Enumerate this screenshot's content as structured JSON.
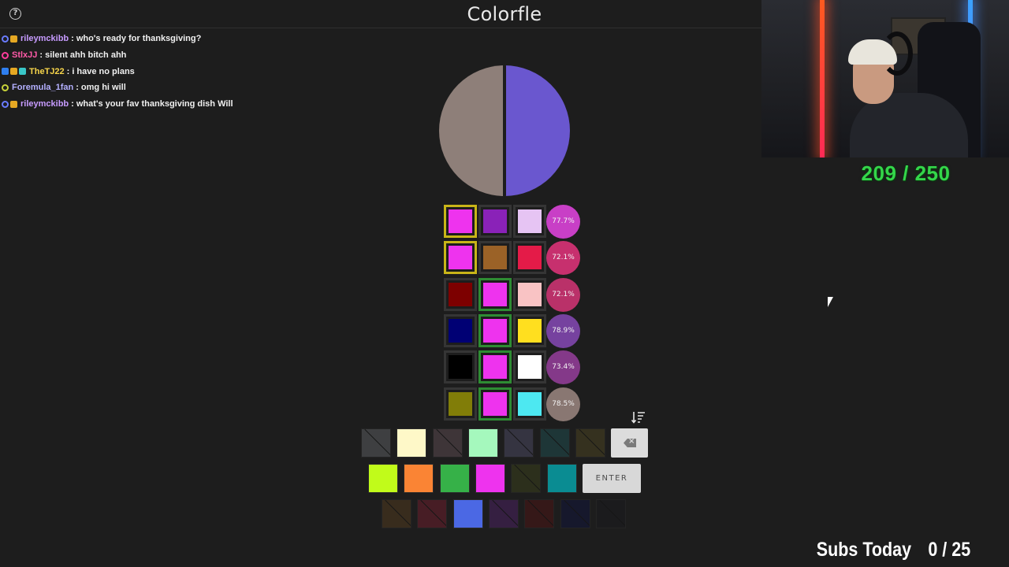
{
  "app": {
    "title": "Colorfle",
    "help_icon": "question-circle-icon",
    "help_glyph": "?"
  },
  "chat": [
    {
      "badges": [
        {
          "type": "circle",
          "color": "#6a7cff"
        },
        {
          "type": "gold"
        }
      ],
      "user": "rileymckibb",
      "user_color": "#c79bff",
      "message": "who's ready for thanksgiving?"
    },
    {
      "badges": [
        {
          "type": "circle",
          "color": "#ff3c9c"
        }
      ],
      "user": "StlxJJ",
      "user_color": "#ff5aa8",
      "message": "silent ahh bitch ahh"
    },
    {
      "badges": [
        {
          "type": "blue"
        },
        {
          "type": "gold"
        },
        {
          "type": "teal"
        }
      ],
      "user": "TheTJ22",
      "user_color": "#f7d54a",
      "message": "i have no plans"
    },
    {
      "badges": [
        {
          "type": "circle",
          "color": "#c9d43a"
        }
      ],
      "user": "Foremula_1fan",
      "user_color": "#b4b0ff",
      "message": "omg hi will"
    },
    {
      "badges": [
        {
          "type": "circle",
          "color": "#6a7cff"
        },
        {
          "type": "gold"
        }
      ],
      "user": "rileymckibb",
      "user_color": "#c79bff",
      "message": "what's your fav thanksgiving dish Will"
    }
  ],
  "overlay": {
    "progress": "209 / 250",
    "subs_label": "Subs Today",
    "subs_value": "0 / 25"
  },
  "target": {
    "left_color": "#8e7f79",
    "right_color": "#6a57cf"
  },
  "guesses": [
    {
      "cells": [
        {
          "color": "#ee33ee",
          "state": "yellow"
        },
        {
          "color": "#8a22b8",
          "state": "none"
        },
        {
          "color": "#e6c4f3",
          "state": "none"
        }
      ],
      "accuracy": "77.7%",
      "accuracy_color": "#d241d0"
    },
    {
      "cells": [
        {
          "color": "#ee33ee",
          "state": "yellow"
        },
        {
          "color": "#9b6227",
          "state": "none"
        },
        {
          "color": "#e41b48",
          "state": "none"
        }
      ],
      "accuracy": "72.1%",
      "accuracy_color": "#d13273"
    },
    {
      "cells": [
        {
          "color": "#7d0000",
          "state": "none"
        },
        {
          "color": "#ee33ee",
          "state": "green"
        },
        {
          "color": "#f9c3c4",
          "state": "none"
        }
      ],
      "accuracy": "72.1%",
      "accuracy_color": "#c3336e"
    },
    {
      "cells": [
        {
          "color": "#000074",
          "state": "none"
        },
        {
          "color": "#ee33ee",
          "state": "green"
        },
        {
          "color": "#ffdf1f",
          "state": "none"
        }
      ],
      "accuracy": "78.9%",
      "accuracy_color": "#7b45a6"
    },
    {
      "cells": [
        {
          "color": "#000000",
          "state": "none"
        },
        {
          "color": "#ee33ee",
          "state": "green"
        },
        {
          "color": "#ffffff",
          "state": "none"
        }
      ],
      "accuracy": "73.4%",
      "accuracy_color": "#8a3b8f"
    },
    {
      "cells": [
        {
          "color": "#817d08",
          "state": "none"
        },
        {
          "color": "#ee33ee",
          "state": "green"
        },
        {
          "color": "#4de8f1",
          "state": "none"
        }
      ],
      "accuracy": "78.5%",
      "accuracy_color": "#8f7c77"
    }
  ],
  "sort_icon": "sort-descending-icon",
  "keyboard": {
    "rows": [
      [
        {
          "color": "#5a5c5f",
          "disabled": true
        },
        {
          "color": "#fef8c8",
          "disabled": false
        },
        {
          "color": "#5a4a4f",
          "disabled": true
        },
        {
          "color": "#a5f8bd",
          "disabled": false
        },
        {
          "color": "#4a4760",
          "disabled": true
        },
        {
          "color": "#1f4c4e",
          "disabled": true
        },
        {
          "color": "#4a4322",
          "disabled": true
        }
      ],
      [
        {
          "color": "#c1fb1a",
          "disabled": false
        },
        {
          "color": "#fa8434",
          "disabled": false
        },
        {
          "color": "#36b148",
          "disabled": false
        },
        {
          "color": "#ee33ee",
          "disabled": false
        },
        {
          "color": "#3a3f1c",
          "disabled": true
        },
        {
          "color": "#0a8c92",
          "disabled": false
        }
      ],
      [
        {
          "color": "#4f3a1e",
          "disabled": true
        },
        {
          "color": "#6b1e2d",
          "disabled": true
        },
        {
          "color": "#4b68e4",
          "disabled": false
        },
        {
          "color": "#4a2160",
          "disabled": true
        },
        {
          "color": "#4a1414",
          "disabled": true
        },
        {
          "color": "#12143a",
          "disabled": true
        },
        {
          "color": "#1a1b1e",
          "disabled": true
        }
      ]
    ],
    "enter_label": "ENTER",
    "backspace_icon": "backspace-icon"
  }
}
